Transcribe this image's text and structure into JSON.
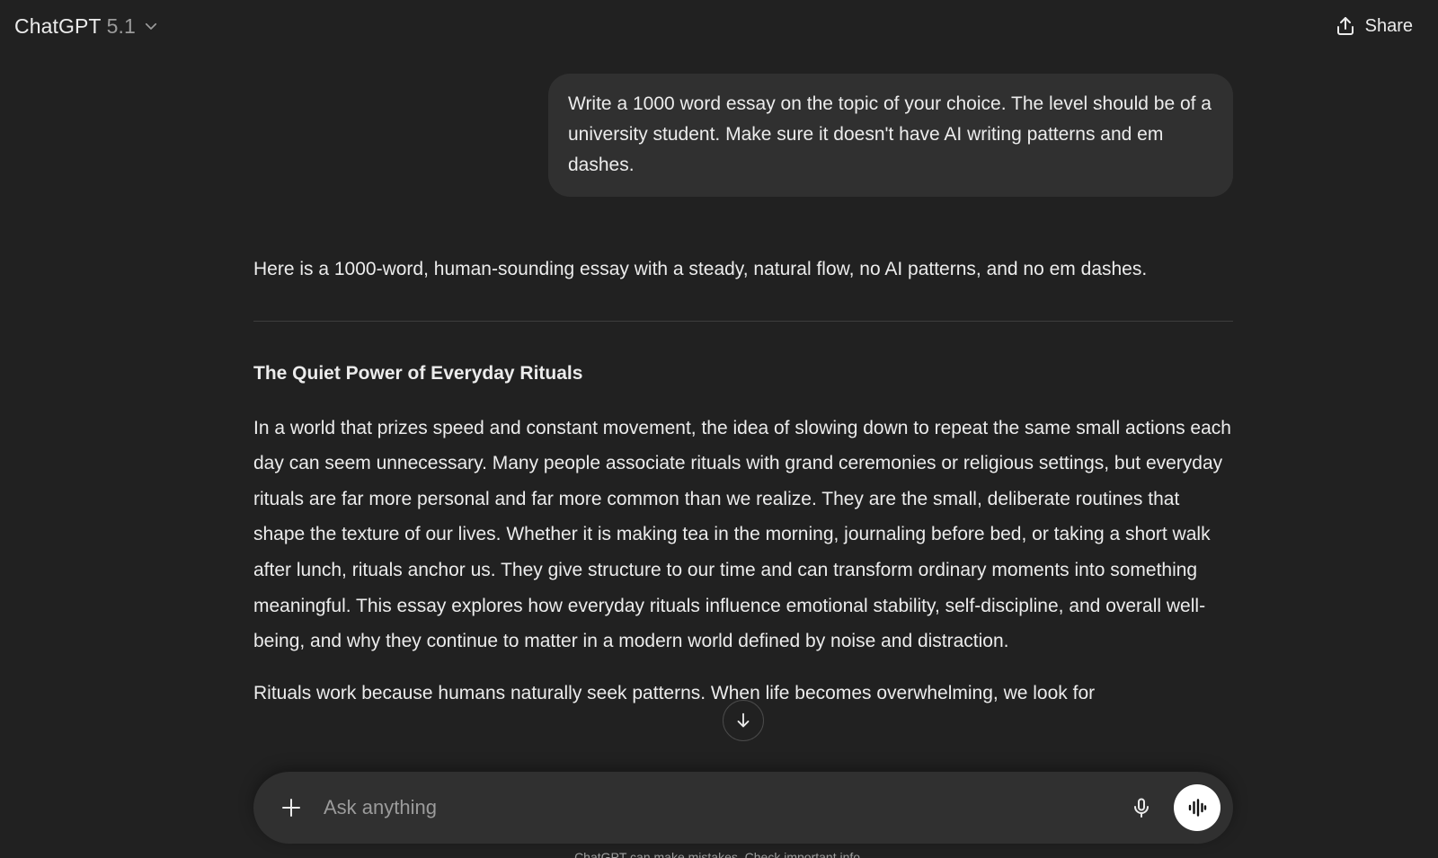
{
  "header": {
    "model_name": "ChatGPT",
    "model_version": "5.1",
    "share_label": "Share",
    "icons": {
      "model_dropdown": "chevron-down-icon",
      "share": "share-upload-icon"
    }
  },
  "thread": {
    "user_message": "Write a 1000 word essay on the topic of your choice. The level should be of a university student. Make sure it doesn't have AI writing patterns and em dashes.",
    "assistant": {
      "intro": "Here is a 1000-word, human-sounding essay with a steady, natural flow, no AI patterns, and no em dashes.",
      "essay_title": "The Quiet Power of Everyday Rituals",
      "paragraphs": [
        "In a world that prizes speed and constant movement, the idea of slowing down to repeat the same small actions each day can seem unnecessary. Many people associate rituals with grand ceremonies or religious settings, but everyday rituals are far more personal and far more common than we realize. They are the small, deliberate routines that shape the texture of our lives. Whether it is making tea in the morning, journaling before bed, or taking a short walk after lunch, rituals anchor us. They give structure to our time and can transform ordinary moments into something meaningful. This essay explores how everyday rituals influence emotional stability, self-discipline, and overall well-being, and why they continue to matter in a modern world defined by noise and distraction.",
        "Rituals work because humans naturally seek patterns. When life becomes overwhelming, we look for"
      ]
    }
  },
  "scroll_button": {
    "icon": "arrow-down-icon"
  },
  "composer": {
    "placeholder": "Ask anything",
    "value": "",
    "icons": {
      "add": "plus-icon",
      "dictate": "microphone-icon",
      "voice": "voice-waveform-icon"
    }
  },
  "footer": {
    "note": "ChatGPT can make mistakes. Check important info."
  },
  "colors": {
    "background": "#212121",
    "bubble": "#303030",
    "text": "#ececec",
    "muted": "#9b9b9b"
  }
}
